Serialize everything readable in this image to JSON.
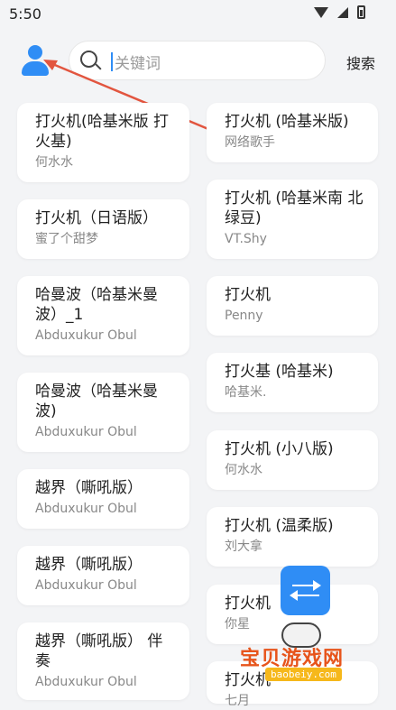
{
  "status": {
    "time": "5:50"
  },
  "search": {
    "placeholder": "关键词",
    "button_label": "搜索"
  },
  "songs": [
    {
      "title": "打火机(哈基米版 打火基)",
      "artist": "何水水"
    },
    {
      "title": "打火机 (哈基米版)",
      "artist": "网络歌手"
    },
    {
      "title": "打火机（日语版）",
      "artist": "蜜了个甜梦"
    },
    {
      "title": "打火机 (哈基米南 北绿豆)",
      "artist": "VT.Shy"
    },
    {
      "title": "哈曼波（哈基米曼 波）_1",
      "artist": "Abduxukur Obul"
    },
    {
      "title": "打火机",
      "artist": "Penny"
    },
    {
      "title": "哈曼波（哈基米曼 波)",
      "artist": "Abduxukur Obul"
    },
    {
      "title": "打火基 (哈基米)",
      "artist": "哈基米."
    },
    {
      "title": "越界（嘶吼版）",
      "artist": "Abduxukur Obul"
    },
    {
      "title": "打火机 (小八版)",
      "artist": "何水水"
    },
    {
      "title": "越界（嘶吼版）",
      "artist": "Abduxukur Obul"
    },
    {
      "title": "打火机 (温柔版)",
      "artist": "刘大拿"
    },
    {
      "title": "越界（嘶吼版） 伴 奏",
      "artist": "Abduxukur Obul"
    },
    {
      "title": "打火机",
      "artist": "你星"
    },
    {
      "title": "打火机",
      "artist": "七月"
    }
  ],
  "watermark": {
    "text": "宝贝游戏网",
    "url": "baobeiy.com"
  },
  "colors": {
    "accent": "#2f8df5",
    "annotation_arrow": "#e2553f",
    "background": "#f3f4f6"
  }
}
